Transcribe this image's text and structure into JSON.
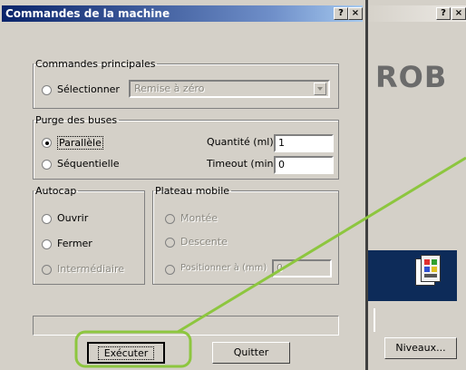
{
  "window": {
    "title": "Commandes de la machine",
    "help_btn": "?",
    "close_btn": "×",
    "bg_help_btn": "?",
    "bg_close_btn": "×"
  },
  "background": {
    "brand_text": "ROB",
    "niveaux_label": "Niveaux..."
  },
  "principales": {
    "legend": "Commandes principales",
    "select_label": "Sélectionner",
    "select_value": "Remise à zéro"
  },
  "purge": {
    "legend": "Purge des buses",
    "parallele": "Parallèle",
    "sequentielle": "Séquentielle",
    "quantite_label": "Quantité (ml):",
    "quantite_value": "1",
    "timeout_label": "Timeout (min):",
    "timeout_value": "0"
  },
  "autocap": {
    "legend": "Autocap",
    "ouvrir": "Ouvrir",
    "fermer": "Fermer",
    "intermediaire": "Intermédiaire"
  },
  "plateau": {
    "legend": "Plateau mobile",
    "montee": "Montée",
    "descente": "Descente",
    "positionner": "Positionner à (mm)",
    "position_value": "0"
  },
  "buttons": {
    "executer": "Exécuter",
    "quitter": "Quitter"
  },
  "colors": {
    "title_bar": "#0a246a",
    "title_bar_end": "#a6caf0",
    "annotation": "#8dc63f"
  }
}
